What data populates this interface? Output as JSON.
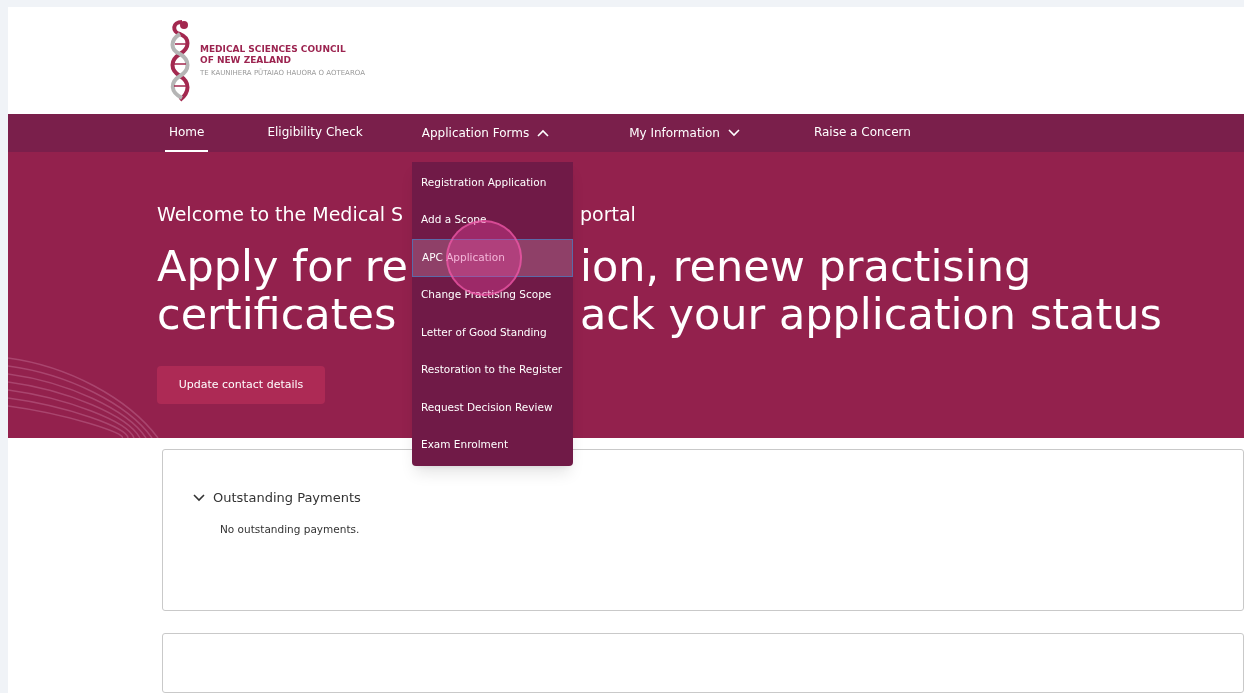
{
  "logo": {
    "line_1": "MEDICAL SCIENCES COUNCIL",
    "line_2": "OF NEW ZEALAND",
    "tagline": "TE KAUNIHERA PŪTAIAO HAUORA O AOTEAROA"
  },
  "nav": [
    {
      "label": "Home",
      "kind": "link",
      "selected": true
    },
    {
      "label": "Eligibility Check",
      "kind": "link",
      "selected": false
    },
    {
      "label": "Application Forms",
      "kind": "menu",
      "selected": false,
      "expanded": true
    },
    {
      "label": "My Information",
      "kind": "menu",
      "selected": false,
      "expanded": false
    },
    {
      "label": "Raise a Concern",
      "kind": "link",
      "selected": false
    }
  ],
  "dropdown": [
    {
      "label": "Registration Application",
      "selected": false
    },
    {
      "label": "Add a Scope",
      "selected": false
    },
    {
      "label": "APC Application",
      "selected": true
    },
    {
      "label": "Change Practising Scope",
      "selected": false
    },
    {
      "label": "Letter of Good Standing",
      "selected": false
    },
    {
      "label": "Restoration to the Register",
      "selected": false
    },
    {
      "label": "Request Decision Review",
      "selected": false
    },
    {
      "label": "Exam Enrolment",
      "selected": false
    }
  ],
  "hero": {
    "welcome": [
      "Welcome to the Medical S",
      "portal"
    ],
    "heading_lines": [
      [
        "Apply for re",
        "ion, renew practising"
      ],
      [
        "certificates",
        "ack your application status"
      ]
    ],
    "button": "Update contact details"
  },
  "sections": [
    {
      "title": "Outstanding Payments",
      "expanded": true,
      "message": "No outstanding payments."
    }
  ]
}
